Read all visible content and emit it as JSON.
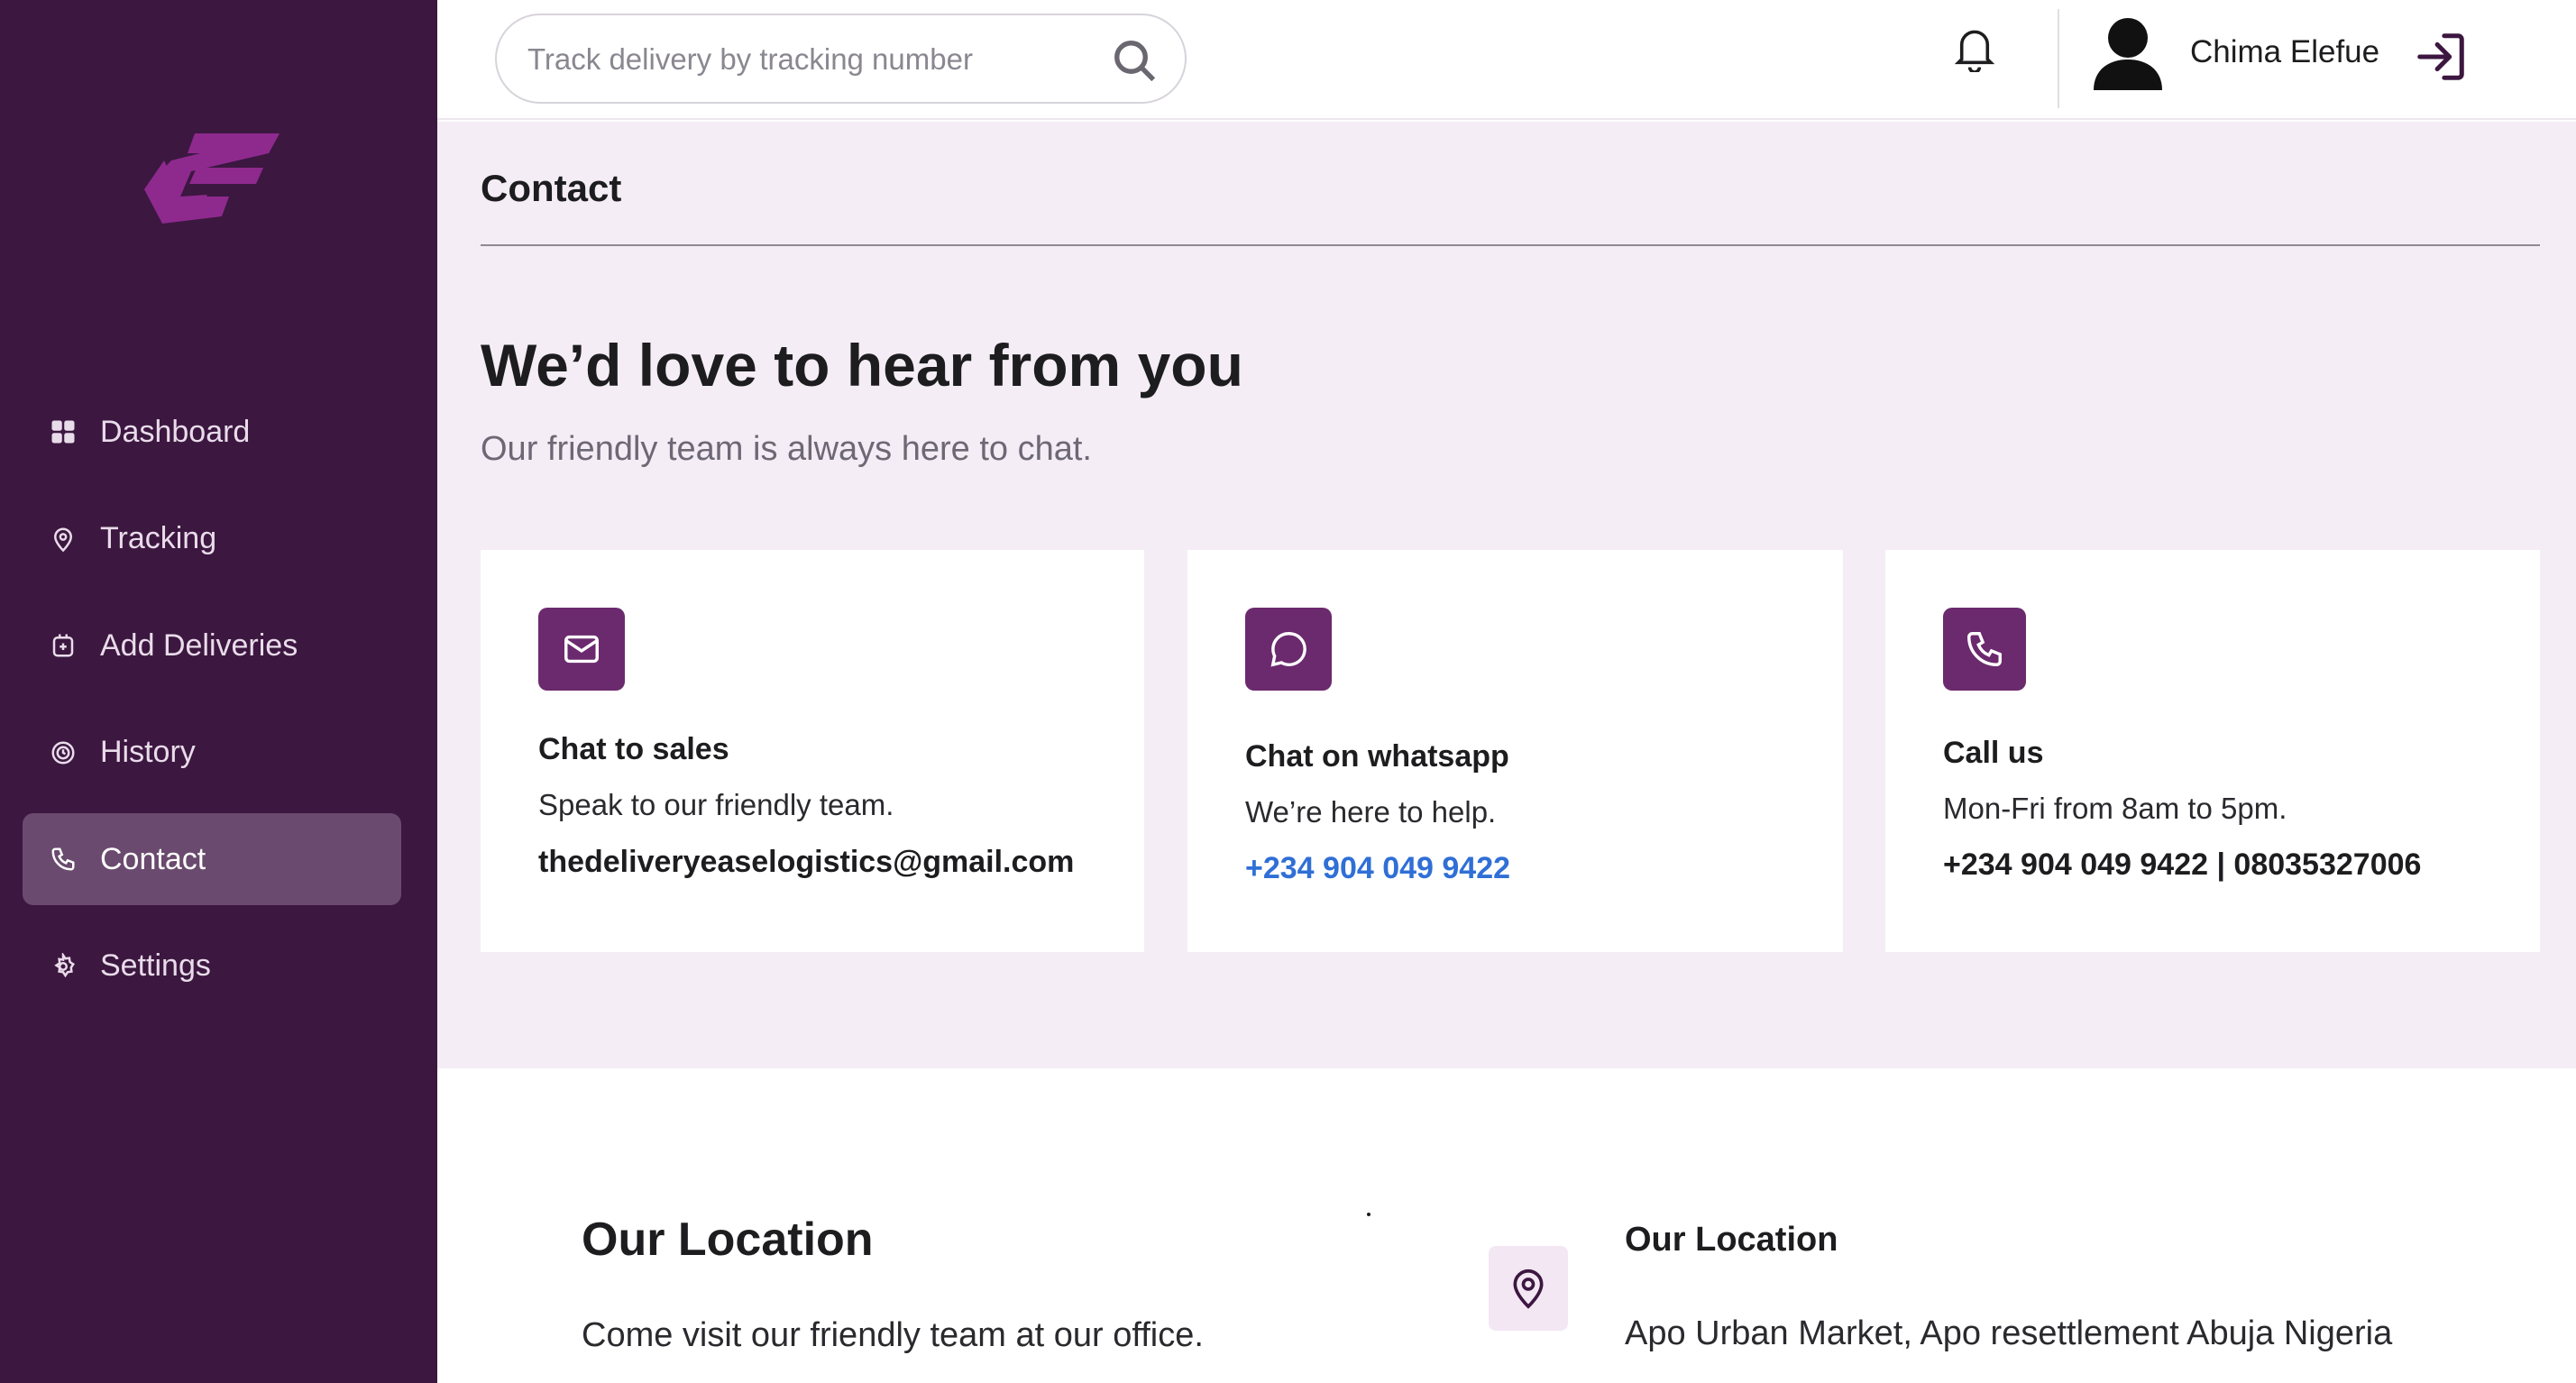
{
  "brand": {
    "logo_color": "#8e2a8e"
  },
  "colors": {
    "sidebar_bg": "#3c1740",
    "active_item_bg": "#6a4a6e",
    "accent": "#6b2a6e",
    "link": "#2f6fd6",
    "main_bg": "#f5edf5"
  },
  "sidebar": {
    "items": [
      {
        "label": "Dashboard",
        "icon": "dashboard-grid-icon"
      },
      {
        "label": "Tracking",
        "icon": "location-pin-icon"
      },
      {
        "label": "Add Deliveries",
        "icon": "add-delivery-icon"
      },
      {
        "label": "History",
        "icon": "history-icon"
      },
      {
        "label": "Contact",
        "icon": "phone-icon",
        "active": true
      },
      {
        "label": "Settings",
        "icon": "gear-icon"
      }
    ]
  },
  "header": {
    "search_placeholder": "Track delivery by tracking number",
    "user_name": "Chima Elefue"
  },
  "page": {
    "title": "Contact",
    "hero_heading": "We’d love to hear from you",
    "hero_subtext": "Our friendly team is always here to chat."
  },
  "cards": [
    {
      "icon": "mail-icon",
      "title": "Chat to sales",
      "text": "Speak to our friendly team.",
      "value": "thedeliveryeaselogistics@gmail.com"
    },
    {
      "icon": "chat-bubble-icon",
      "title": "Chat on whatsapp",
      "text": "We’re here to help.",
      "value": "+234 904 049 9422"
    },
    {
      "icon": "phone-icon",
      "title": "Call us",
      "text": "Mon-Fri from 8am to 5pm.",
      "value": "+234 904 049 9422 | 08035327006"
    }
  ],
  "location": {
    "heading": "Our Location",
    "text": "Come visit our friendly team at our office.",
    "detail_heading": "Our Location",
    "address": "Apo Urban Market, Apo resettlement Abuja Nigeria"
  }
}
